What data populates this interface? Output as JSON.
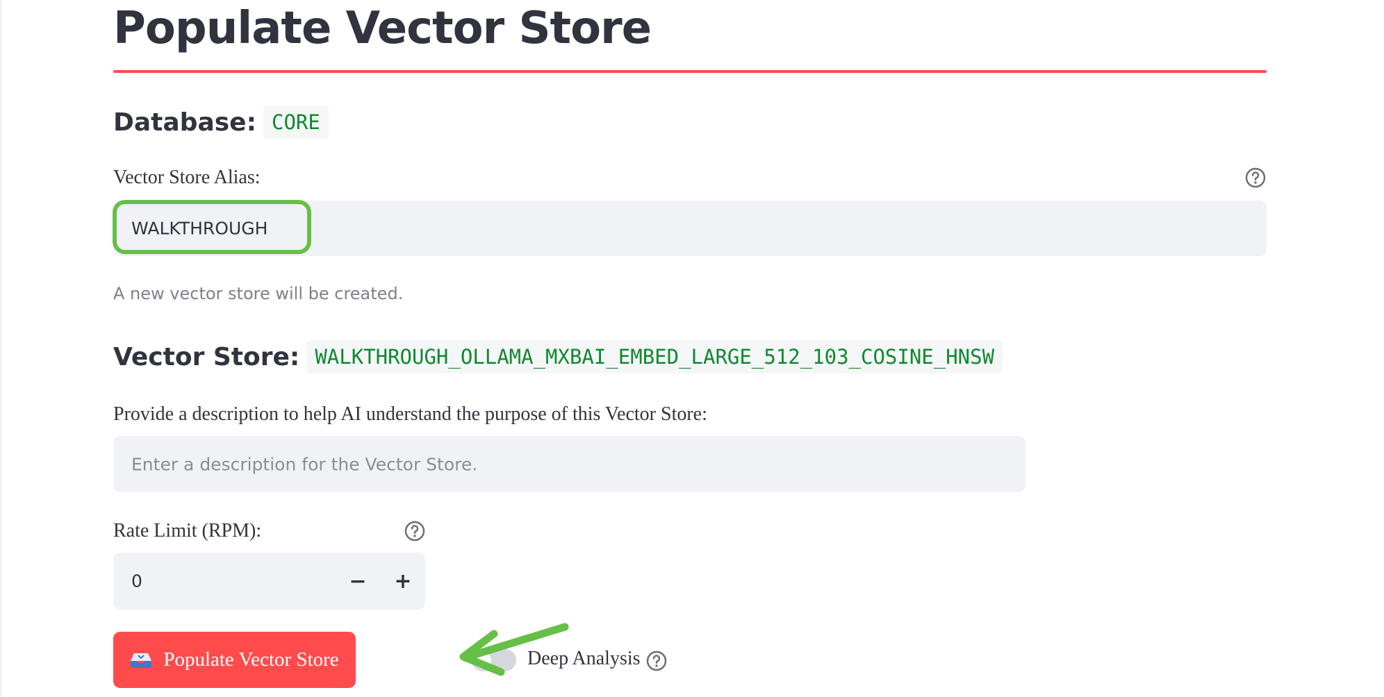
{
  "page": {
    "title": "Populate Vector Store"
  },
  "database": {
    "label": "Database:",
    "value": "CORE"
  },
  "alias": {
    "label": "Vector Store Alias:",
    "value": "WALKTHROUGH",
    "help_icon": "question-circle-icon"
  },
  "status": {
    "message": "A new vector store will be created."
  },
  "vector_store": {
    "label": "Vector Store:",
    "value": "WALKTHROUGH_OLLAMA_MXBAI_EMBED_LARGE_512_103_COSINE_HNSW"
  },
  "description": {
    "label": "Provide a description to help AI understand the purpose of this Vector Store:",
    "placeholder": "Enter a description for the Vector Store."
  },
  "rate_limit": {
    "label": "Rate Limit (RPM):",
    "value": "0",
    "decrement_label": "−",
    "increment_label": "+"
  },
  "actions": {
    "populate_label": "Populate Vector Store",
    "populate_icon": "inbox-tray-icon"
  },
  "deep_analysis": {
    "label": "Deep Analysis",
    "enabled": false
  },
  "colors": {
    "accent": "#ff4b4b",
    "code_text": "#0f8a2e",
    "input_bg": "#f0f2f6",
    "highlight": "#66bf47"
  }
}
